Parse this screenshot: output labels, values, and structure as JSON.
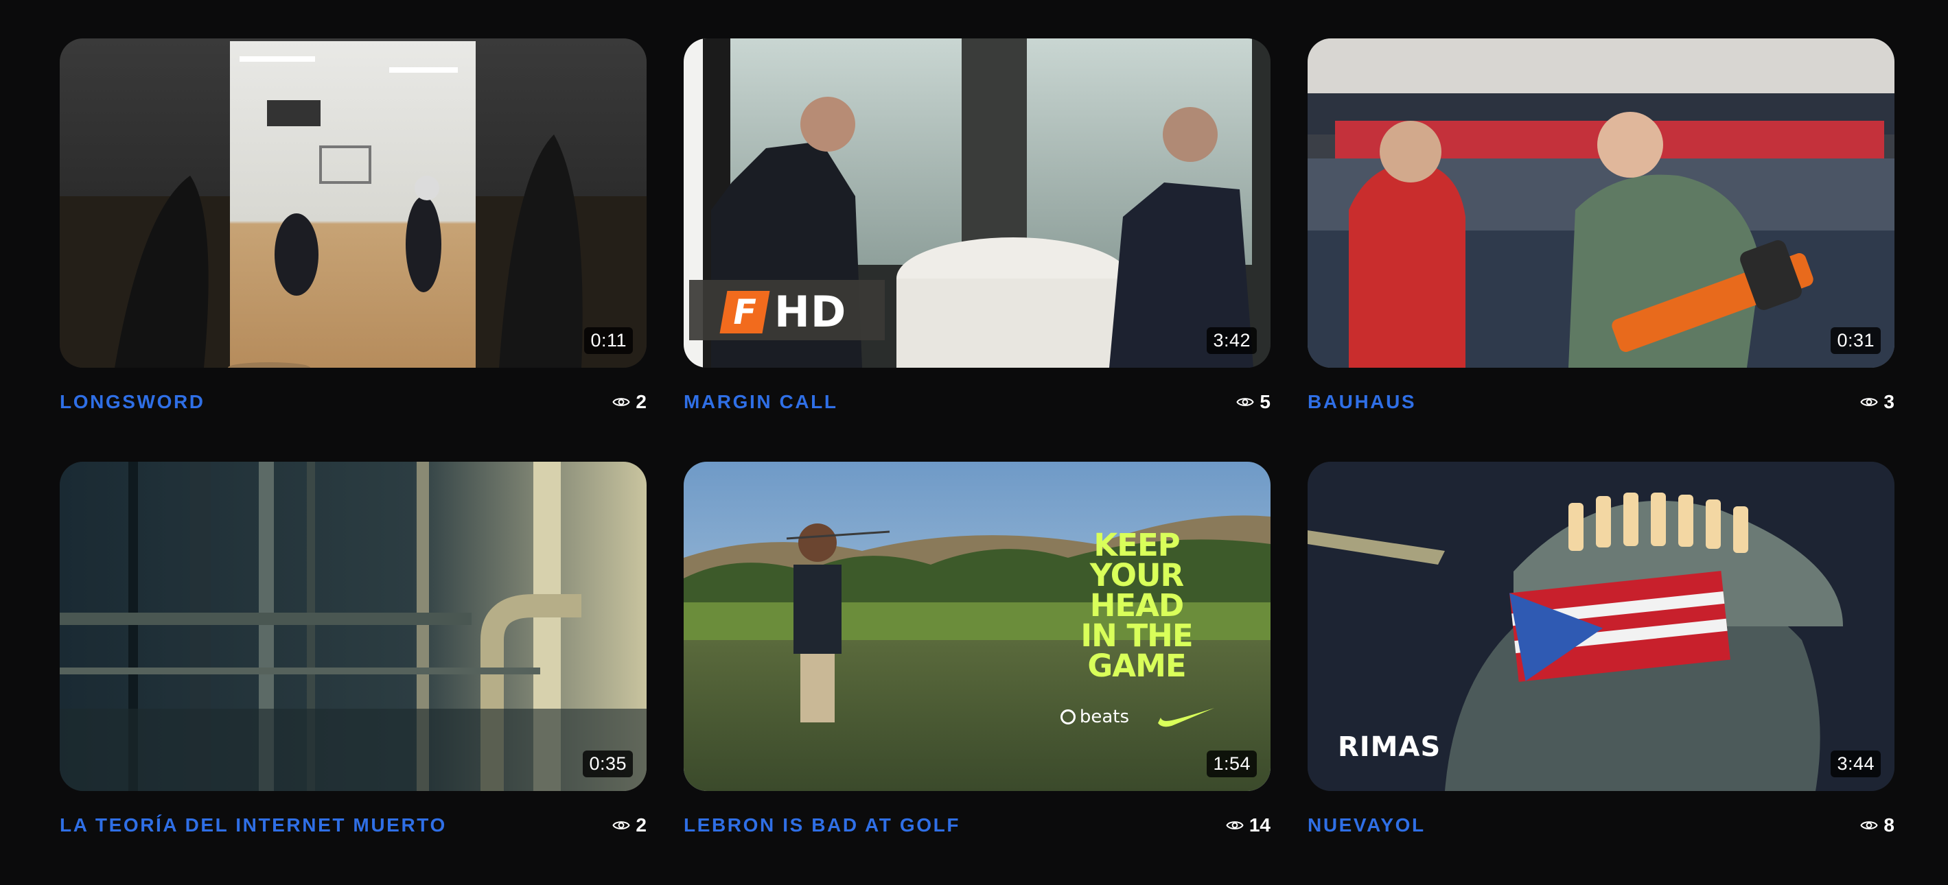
{
  "videos": [
    {
      "title": "LONGSWORD",
      "duration": "0:11",
      "views": "2",
      "thumbnail_icon": "fencing-gym-still"
    },
    {
      "title": "MARGIN CALL",
      "duration": "3:42",
      "views": "5",
      "thumbnail_icon": "dinner-table-still",
      "overlay_badge": "HD"
    },
    {
      "title": "BAUHAUS",
      "duration": "0:31",
      "views": "3",
      "thumbnail_icon": "hardware-store-still"
    },
    {
      "title": "LA TEORÍA DEL INTERNET MUERTO",
      "duration": "0:35",
      "views": "2",
      "thumbnail_icon": "pipes-still"
    },
    {
      "title": "LEBRON IS BAD AT GOLF",
      "duration": "1:54",
      "views": "14",
      "thumbnail_icon": "golf-lake-still",
      "overlay_headline": [
        "KEEP",
        "YOUR",
        "HEAD",
        "IN THE",
        "GAME"
      ],
      "overlay_brand": "beats"
    },
    {
      "title": "NUEVAYOL",
      "duration": "3:44",
      "views": "8",
      "thumbnail_icon": "statue-of-liberty-still",
      "overlay_brand": "RIMAS"
    }
  ],
  "colors": {
    "background": "#0b0b0c",
    "title_accent": "#2f6fe6",
    "headline_yellow": "#d9ff5a"
  },
  "icons": {
    "views": "eye-icon"
  }
}
